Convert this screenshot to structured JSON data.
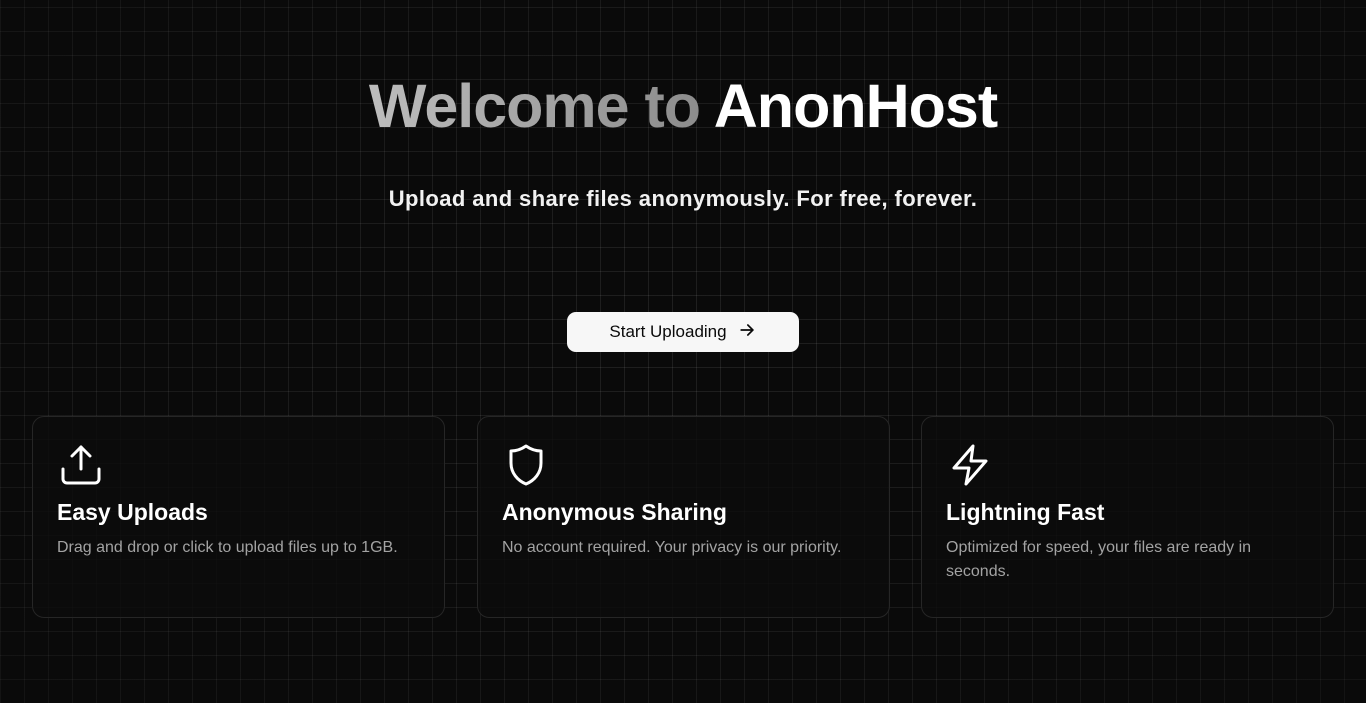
{
  "hero": {
    "title_prefix": "Welcome to ",
    "title_brand": "AnonHost",
    "subtitle": "Upload and share files anonymously. For free, forever."
  },
  "cta": {
    "label": "Start Uploading",
    "icon": "arrow-right-icon"
  },
  "features": [
    {
      "icon": "upload-icon",
      "title": "Easy Uploads",
      "description": "Drag and drop or click to upload files up to 1GB."
    },
    {
      "icon": "shield-icon",
      "title": "Anonymous Sharing",
      "description": "No account required. Your privacy is our priority."
    },
    {
      "icon": "lightning-icon",
      "title": "Lightning Fast",
      "description": "Optimized for speed, your files are ready in seconds."
    }
  ],
  "colors": {
    "background": "#0a0a0a",
    "button_bg": "#f7f7f7",
    "card_border": "#262626",
    "muted_text": "#a3a3a3"
  }
}
